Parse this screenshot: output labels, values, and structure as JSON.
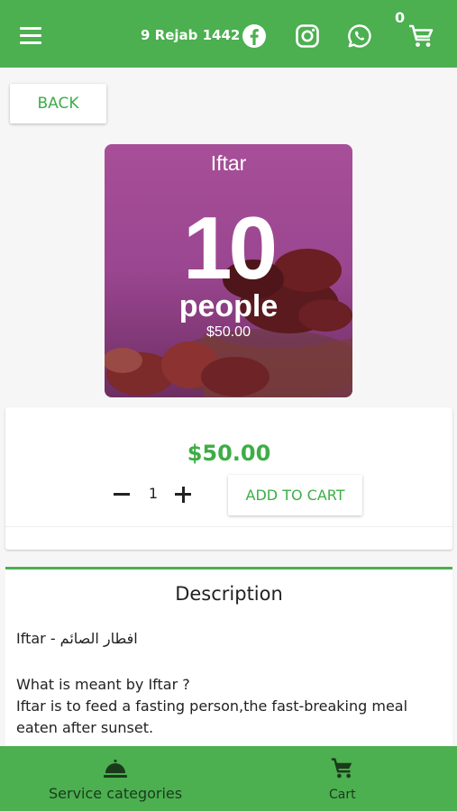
{
  "header": {
    "date": "9 Rejab 1442",
    "cart_count": "0",
    "icons": [
      "menu-icon",
      "facebook-icon",
      "instagram-icon",
      "whatsapp-icon",
      "cart-icon"
    ]
  },
  "back_label": "BACK",
  "product_image": {
    "title": "Iftar",
    "count": "10",
    "unit": "people",
    "price": "$50.00"
  },
  "product": {
    "price": "$50.00",
    "quantity": "1",
    "add_to_cart_label": "ADD TO CART"
  },
  "description": {
    "title": "Description",
    "line1": "Iftar - افطار الصائم",
    "line2": "What is meant by Iftar ?",
    "line3": "Iftar is to feed a fasting person,the fast-breaking meal",
    "line4": "eaten after sunset."
  },
  "bottom_nav": {
    "items": [
      {
        "label": "Service categories",
        "icon": "food-tray-icon"
      },
      {
        "label": "Cart",
        "icon": "cart-icon"
      }
    ]
  },
  "colors": {
    "primary_green": "#4caf50",
    "accent_green": "#3cae45",
    "image_purple": "#a74f98"
  }
}
